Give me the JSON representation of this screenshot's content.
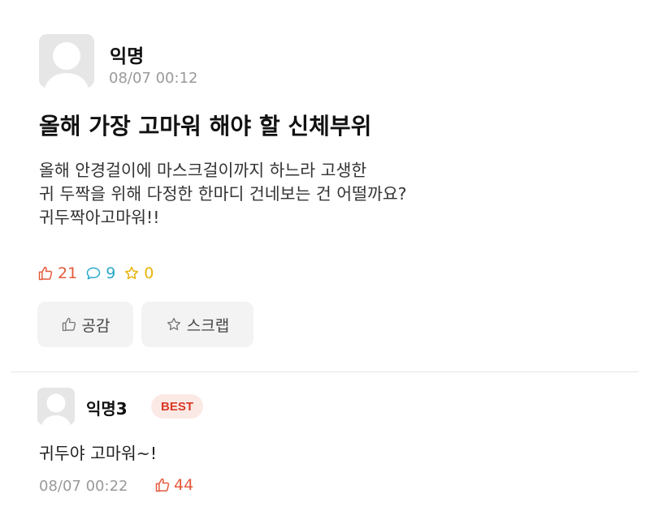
{
  "post": {
    "author": "익명",
    "date": "08/07 00:12",
    "title": "올해 가장 고마워 해야 할 신체부위",
    "body_lines": [
      "올해 안경걸이에 마스크걸이까지 하느라 고생한",
      "귀 두짝을 위해 다정한 한마디 건네보는 건 어떨까요?",
      "귀두짝아고마워!!"
    ],
    "stats": {
      "likes": "21",
      "comments": "9",
      "scraps": "0"
    },
    "actions": {
      "like_label": "공감",
      "scrap_label": "스크랩"
    }
  },
  "comment": {
    "author": "익명3",
    "badge": "BEST",
    "text": "귀두야 고마워~!",
    "date": "08/07 00:22",
    "likes": "44"
  },
  "colors": {
    "like": "#e45a3b",
    "comment": "#2aa8c9",
    "scrap": "#e9b20a",
    "badge_bg": "#fbe9e6",
    "badge_text": "#d73a26"
  },
  "icons": {
    "avatar": "default-avatar-icon",
    "like": "thumbs-up-icon",
    "comment": "speech-bubble-icon",
    "scrap": "star-icon"
  }
}
